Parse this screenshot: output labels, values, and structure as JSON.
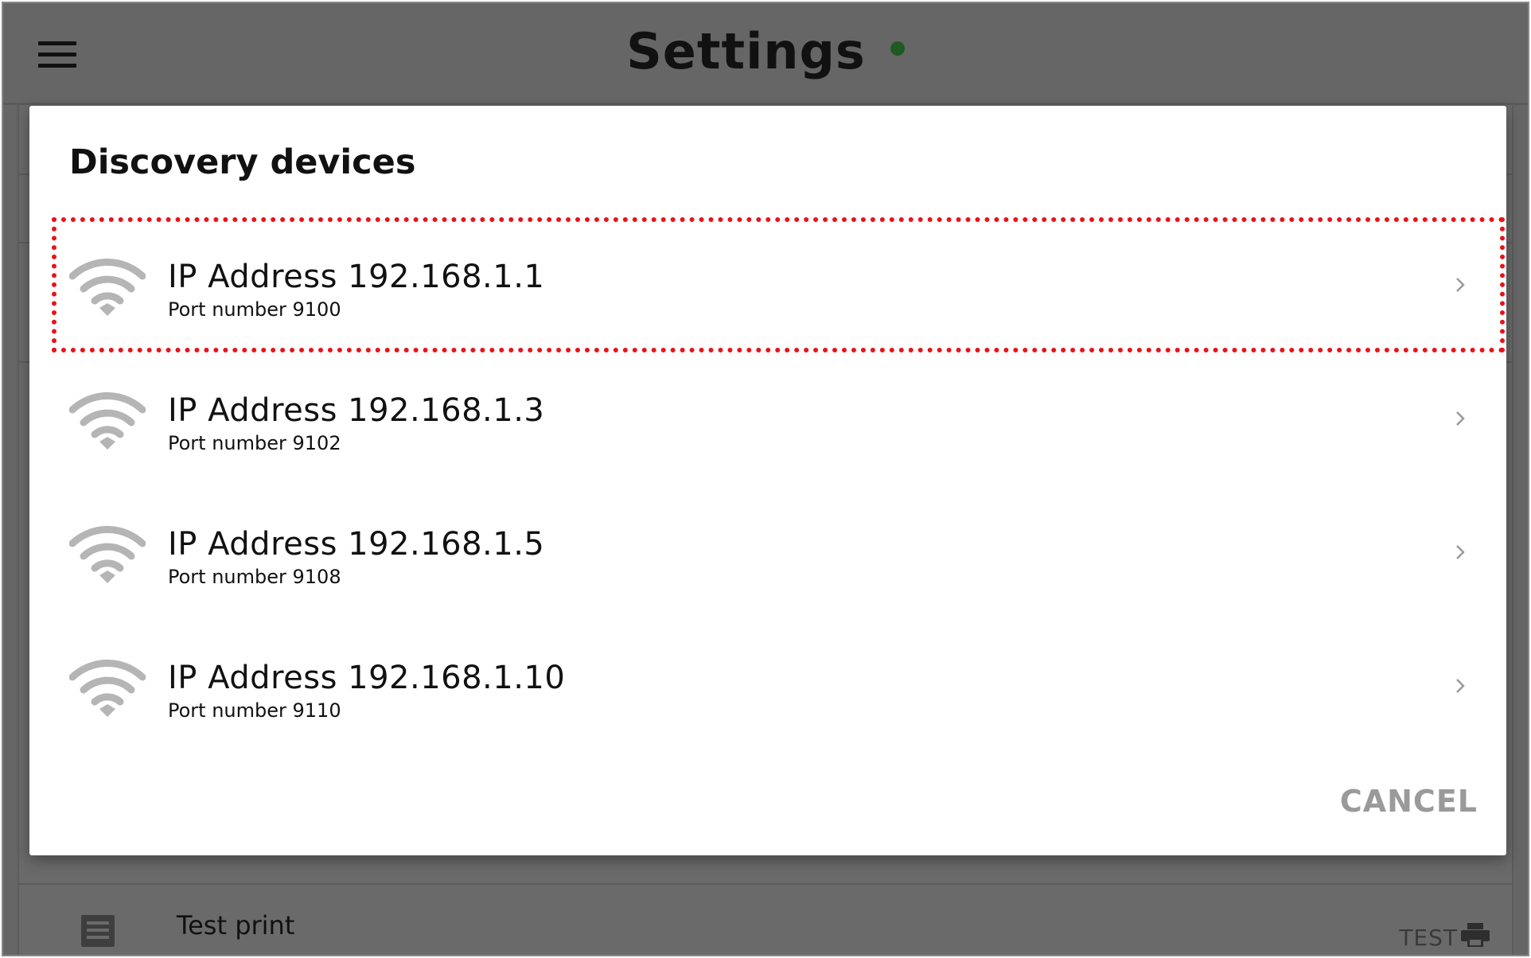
{
  "app": {
    "title": "Settings",
    "status_color": "#1e5a22"
  },
  "dialog": {
    "title": "Discovery devices",
    "devices": [
      {
        "ip_label": "IP Address 192.168.1.1",
        "port_label": "Port number 9100",
        "highlighted": true
      },
      {
        "ip_label": "IP Address 192.168.1.3",
        "port_label": "Port number 9102",
        "highlighted": false
      },
      {
        "ip_label": "IP Address 192.168.1.5",
        "port_label": "Port number 9108",
        "highlighted": false
      },
      {
        "ip_label": "IP Address 192.168.1.10",
        "port_label": "Port number 9110",
        "highlighted": false
      }
    ],
    "cancel_label": "CANCEL",
    "highlight_color": "#e8131b"
  },
  "background": {
    "test_print_label": "Test print",
    "test_button_label": "TEST"
  },
  "icons": {
    "menu": "menu-icon",
    "wifi": "wifi-icon",
    "chevron": "chevron-right-icon",
    "doc": "document-icon",
    "printer": "printer-icon"
  }
}
